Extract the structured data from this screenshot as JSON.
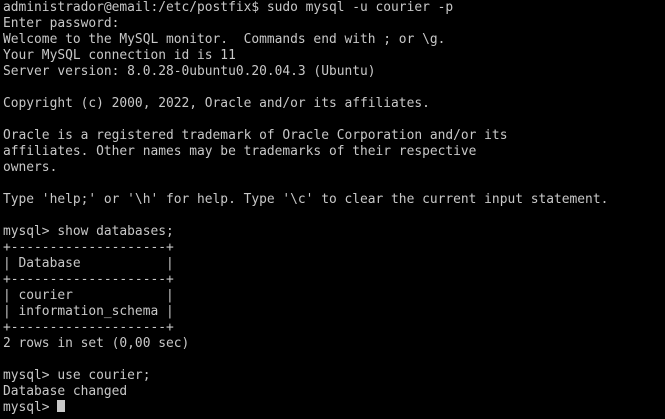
{
  "terminal": {
    "colors": {
      "background": "#000000",
      "foreground": "#c8c8c8"
    },
    "lines": [
      "administrador@email:/etc/postfix$ sudo mysql -u courier -p",
      "Enter password:",
      "Welcome to the MySQL monitor.  Commands end with ; or \\g.",
      "Your MySQL connection id is 11",
      "Server version: 8.0.28-0ubuntu0.20.04.3 (Ubuntu)",
      "",
      "Copyright (c) 2000, 2022, Oracle and/or its affiliates.",
      "",
      "Oracle is a registered trademark of Oracle Corporation and/or its",
      "affiliates. Other names may be trademarks of their respective",
      "owners.",
      "",
      "Type 'help;' or '\\h' for help. Type '\\c' to clear the current input statement.",
      "",
      "mysql> show databases;",
      "+--------------------+",
      "| Database           |",
      "+--------------------+",
      "| courier            |",
      "| information_schema |",
      "+--------------------+",
      "2 rows in set (0,00 sec)",
      "",
      "mysql> use courier;",
      "Database changed"
    ],
    "prompt": "mysql> "
  }
}
